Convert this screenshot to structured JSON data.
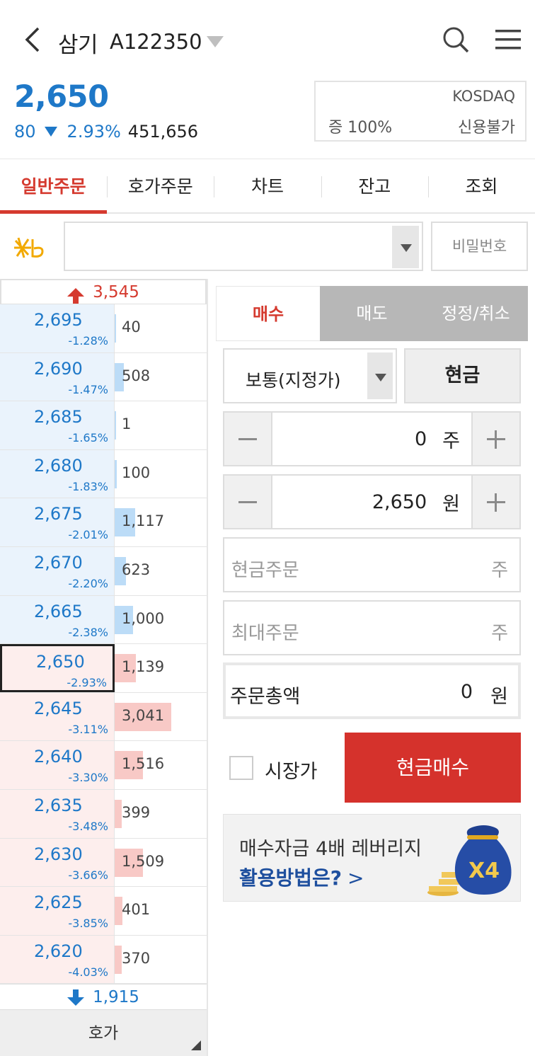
{
  "header": {
    "stock_name": "삼기",
    "stock_code": "A122350",
    "price": "2,650",
    "change": "80",
    "change_rate": "2.93%",
    "volume": "451,656",
    "market": "KOSDAQ",
    "margin": "증 100%",
    "credit": "신용불가"
  },
  "tabs": [
    "일반주문",
    "호가주문",
    "차트",
    "잔고",
    "조회"
  ],
  "account": {
    "value": "",
    "password_placeholder": "비밀번호"
  },
  "orderbook": {
    "upper_limit": "3,545",
    "lower_limit": "1,915",
    "rows": [
      {
        "price": "2,695",
        "rate": "-1.28%",
        "qty": "40",
        "side": "ask"
      },
      {
        "price": "2,690",
        "rate": "-1.47%",
        "qty": "508",
        "side": "ask"
      },
      {
        "price": "2,685",
        "rate": "-1.65%",
        "qty": "1",
        "side": "ask"
      },
      {
        "price": "2,680",
        "rate": "-1.83%",
        "qty": "100",
        "side": "ask"
      },
      {
        "price": "2,675",
        "rate": "-2.01%",
        "qty": "1,117",
        "side": "ask"
      },
      {
        "price": "2,670",
        "rate": "-2.20%",
        "qty": "623",
        "side": "ask"
      },
      {
        "price": "2,665",
        "rate": "-2.38%",
        "qty": "1,000",
        "side": "ask"
      },
      {
        "price": "2,650",
        "rate": "-2.93%",
        "qty": "1,139",
        "side": "bid"
      },
      {
        "price": "2,645",
        "rate": "-3.11%",
        "qty": "3,041",
        "side": "bid"
      },
      {
        "price": "2,640",
        "rate": "-3.30%",
        "qty": "1,516",
        "side": "bid"
      },
      {
        "price": "2,635",
        "rate": "-3.48%",
        "qty": "399",
        "side": "bid"
      },
      {
        "price": "2,630",
        "rate": "-3.66%",
        "qty": "1,509",
        "side": "bid"
      },
      {
        "price": "2,625",
        "rate": "-3.85%",
        "qty": "401",
        "side": "bid"
      },
      {
        "price": "2,620",
        "rate": "-4.03%",
        "qty": "370",
        "side": "bid"
      }
    ],
    "hoga_label": "호가"
  },
  "order": {
    "tabs": [
      "매수",
      "매도",
      "정정/취소"
    ],
    "order_type": "보통(지정가)",
    "cash_label": "현금",
    "qty_value": "0",
    "qty_unit": "주",
    "price_value": "2,650",
    "price_unit": "원",
    "cash_order_label": "현금주문",
    "cash_order_unit": "주",
    "max_order_label": "최대주문",
    "max_order_unit": "주",
    "total_label": "주문총액",
    "total_value": "0",
    "total_unit": "원",
    "market_price_label": "시장가",
    "submit_label": "현금매수"
  },
  "banner": {
    "line1": "매수자금 4배 레버리지",
    "line2": "활용방법은?",
    "badge": "X4"
  },
  "colors": {
    "up": "#d53a2f",
    "down": "#1e78c8",
    "buy_button": "#d5322c"
  }
}
